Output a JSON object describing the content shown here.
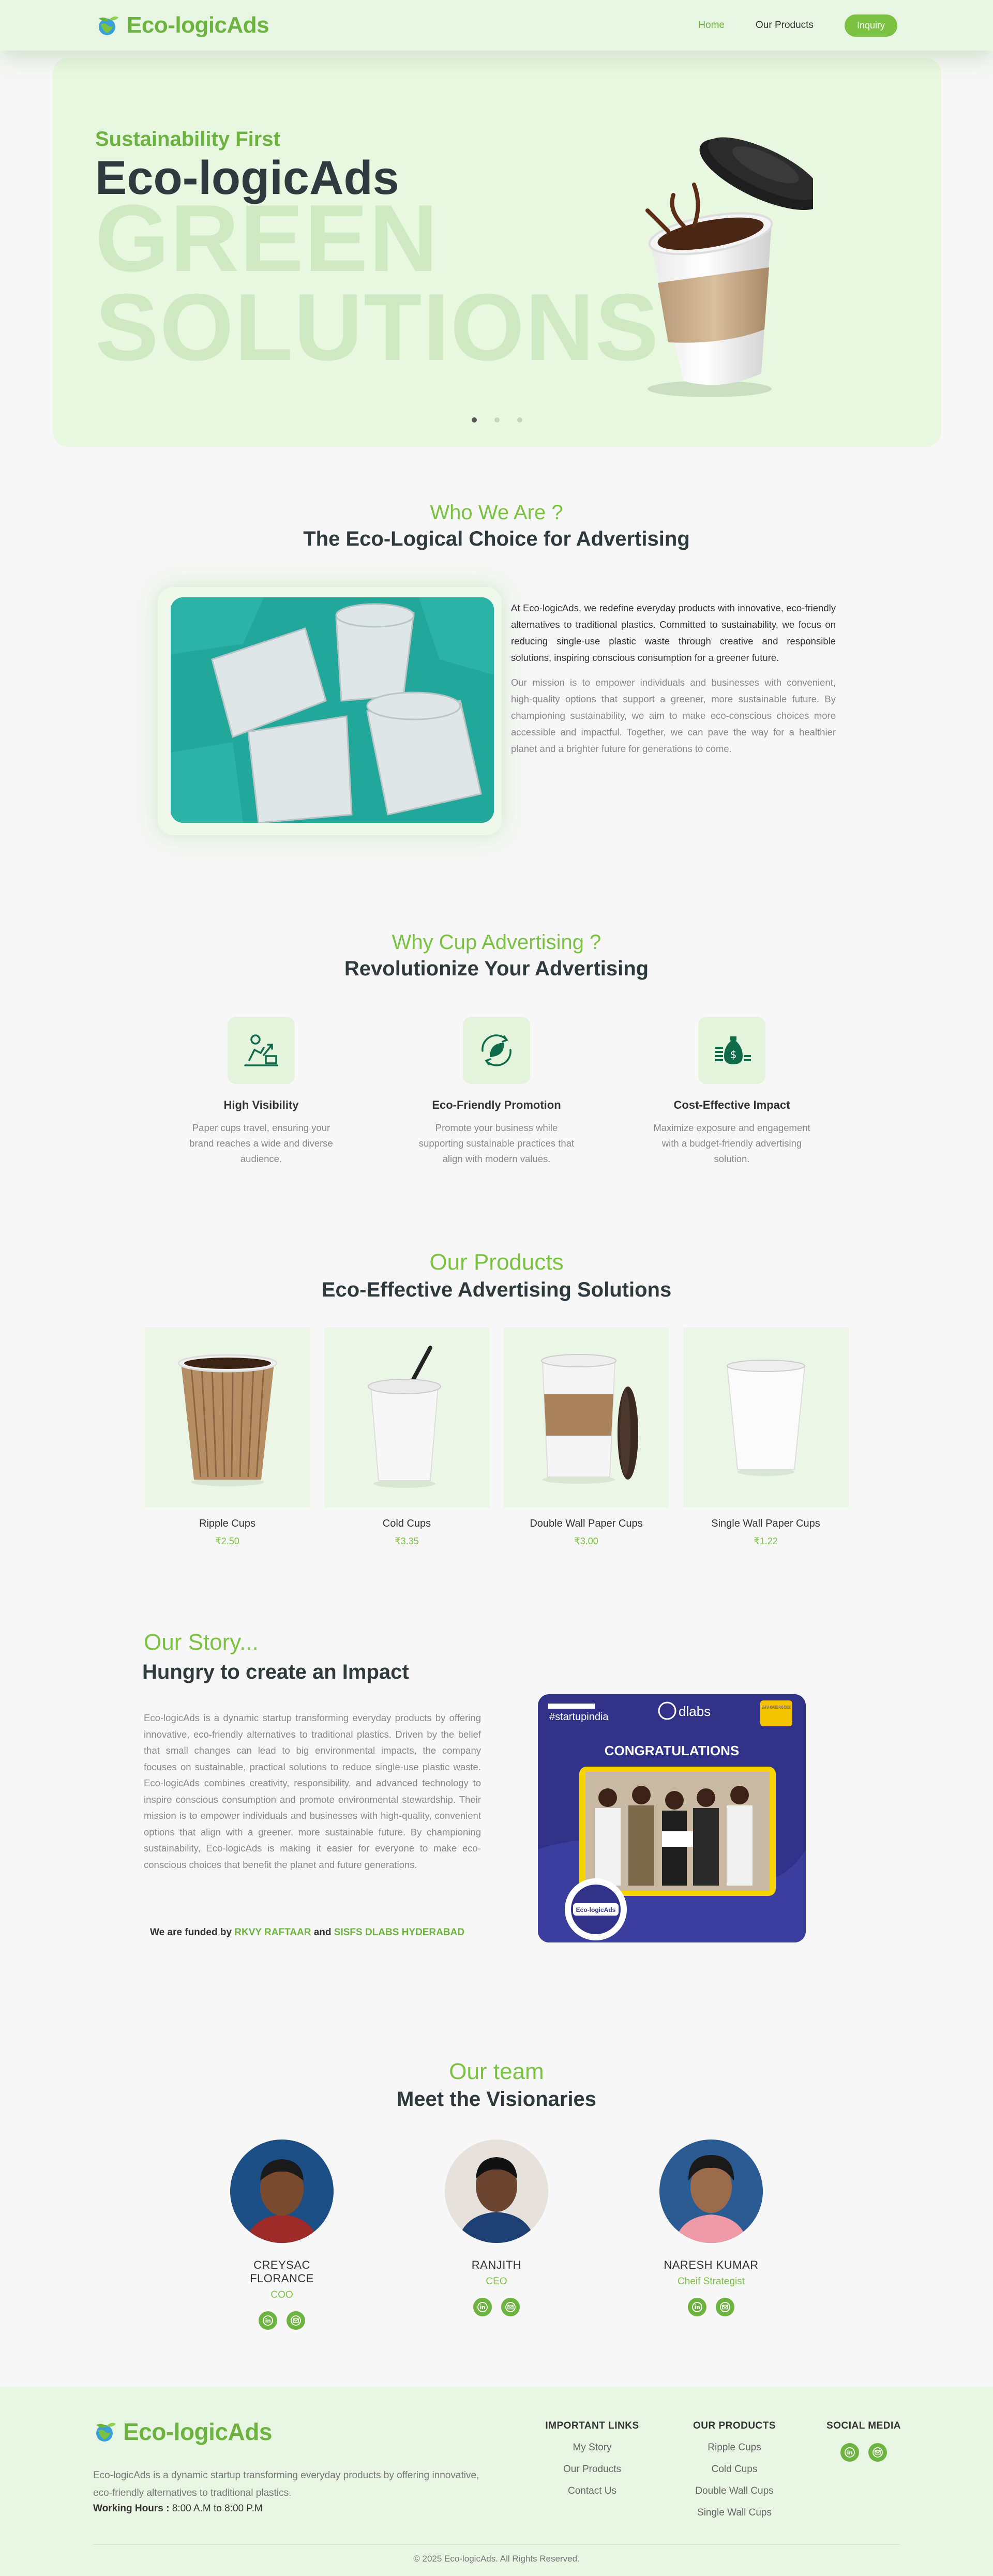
{
  "nav": {
    "brand": "Eco-logicAds",
    "links": [
      {
        "label": "Home"
      },
      {
        "label": "Our Products"
      }
    ],
    "inquiry": "Inquiry"
  },
  "hero": {
    "subtitle": "Sustainability First",
    "title": "Eco-logicAds",
    "big_line1": "GREEN",
    "big_line2": "SOLUTIONS",
    "slides": 3,
    "active_slide": 1
  },
  "who": {
    "eyebrow": "Who We Are ?",
    "heading": "The Eco-Logical Choice for Advertising",
    "para1": "At Eco-logicAds, we redefine everyday products with innovative, eco-friendly alternatives to traditional plastics. Committed to sustainability, we focus on reducing single-use plastic waste through creative and responsible solutions, inspiring conscious consumption for a greener future.",
    "para2": "Our mission is to empower individuals and businesses with convenient, high-quality options that support a greener, more sustainable future. By championing sustainability, we aim to make eco-conscious choices more accessible and impactful. Together, we can pave the way for a healthier planet and a brighter future for generations to come."
  },
  "why": {
    "eyebrow": "Why Cup Advertising ?",
    "heading": "Revolutionize Your Advertising",
    "features": [
      {
        "icon": "growth-chart-icon",
        "title": "High Visibility",
        "desc": "Paper cups travel, ensuring your brand reaches a wide and diverse audience."
      },
      {
        "icon": "eco-leaf-icon",
        "title": "Eco-Friendly Promotion",
        "desc": "Promote your business while supporting sustainable practices that align with modern values."
      },
      {
        "icon": "money-bag-icon",
        "title": "Cost-Effective Impact",
        "desc": "Maximize exposure and engagement with a budget-friendly advertising solution."
      }
    ]
  },
  "products": {
    "eyebrow": "Our Products",
    "heading": "Eco-Effective Advertising Solutions",
    "items": [
      {
        "name": "Ripple Cups",
        "price": "₹2.50"
      },
      {
        "name": "Cold Cups",
        "price": "₹3.35"
      },
      {
        "name": "Double Wall Paper Cups",
        "price": "₹3.00"
      },
      {
        "name": "Single Wall Paper Cups",
        "price": "₹1.22"
      }
    ]
  },
  "story": {
    "eyebrow": "Our Story...",
    "heading": "Hungry to create an Impact",
    "para": "Eco-logicAds is a dynamic startup transforming everyday products by offering innovative, eco-friendly alternatives to traditional plastics. Driven by the belief that small changes can lead to big environmental impacts, the company focuses on sustainable, practical solutions to reduce single-use plastic waste. Eco-logicAds combines creativity, responsibility, and advanced technology to inspire conscious consumption and promote environmental stewardship. Their mission is to empower individuals and businesses with high-quality, convenient options that align with a greener, more sustainable future. By championing sustainability, Eco-logicAds is making it easier for everyone to make eco-conscious choices that benefit the planet and future generations.",
    "funded_prefix": "We are funded by",
    "funder1": "RKVY RAFTAAR",
    "funded_and": "and",
    "funder2": "SISFS DLABS HYDERABAD",
    "photo": {
      "tag": "#startupindia",
      "partner": "dlabs",
      "scheme": "STARTUP INDIA SEED FUND SCHEME",
      "banner": "CONGRATULATIONS",
      "badge": "Eco-logicAds"
    }
  },
  "team": {
    "eyebrow": "Our team",
    "heading": "Meet the Visionaries",
    "members": [
      {
        "name": "CREYSAC FLORANCE",
        "role": "COO"
      },
      {
        "name": "RANJITH",
        "role": "CEO"
      },
      {
        "name": "NARESH KUMAR",
        "role": "Cheif Strategist"
      }
    ]
  },
  "footer": {
    "brand": "Eco-logicAds",
    "desc": "Eco-logicAds is a dynamic startup transforming everyday products by offering innovative, eco-friendly alternatives to traditional plastics.",
    "hours_label": "Working Hours :",
    "hours": "8:00 A.M to 8:00 P.M",
    "col1": {
      "title": "IMPORTANT LINKS",
      "links": [
        "My Story",
        "Our Products",
        "Contact Us"
      ]
    },
    "col2": {
      "title": "OUR PRODUCTS",
      "links": [
        "Ripple Cups",
        "Cold Cups",
        "Double Wall Cups",
        "Single Wall Cups"
      ]
    },
    "col3": {
      "title": "SOCIAL MEDIA"
    },
    "copyright": "© 2025 Eco-logicAds. All Rights Reserved."
  },
  "colors": {
    "accent": "#6cb33f",
    "hero_bg": "#e8f7df",
    "text_dark": "#2e3a3e"
  }
}
